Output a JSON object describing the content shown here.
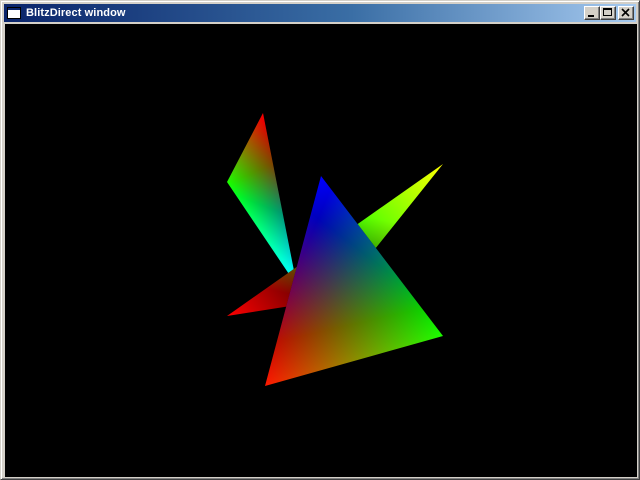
{
  "window": {
    "title": "BlitzDirect window"
  },
  "title_buttons": {
    "minimize_icon": "minimize-icon",
    "maximize_icon": "maximize-icon",
    "close_icon": "close-icon"
  },
  "scene": {
    "background": "#000000",
    "colors": {
      "red": "#ff0000",
      "green": "#00ff00",
      "blue": "#0000ff"
    }
  }
}
